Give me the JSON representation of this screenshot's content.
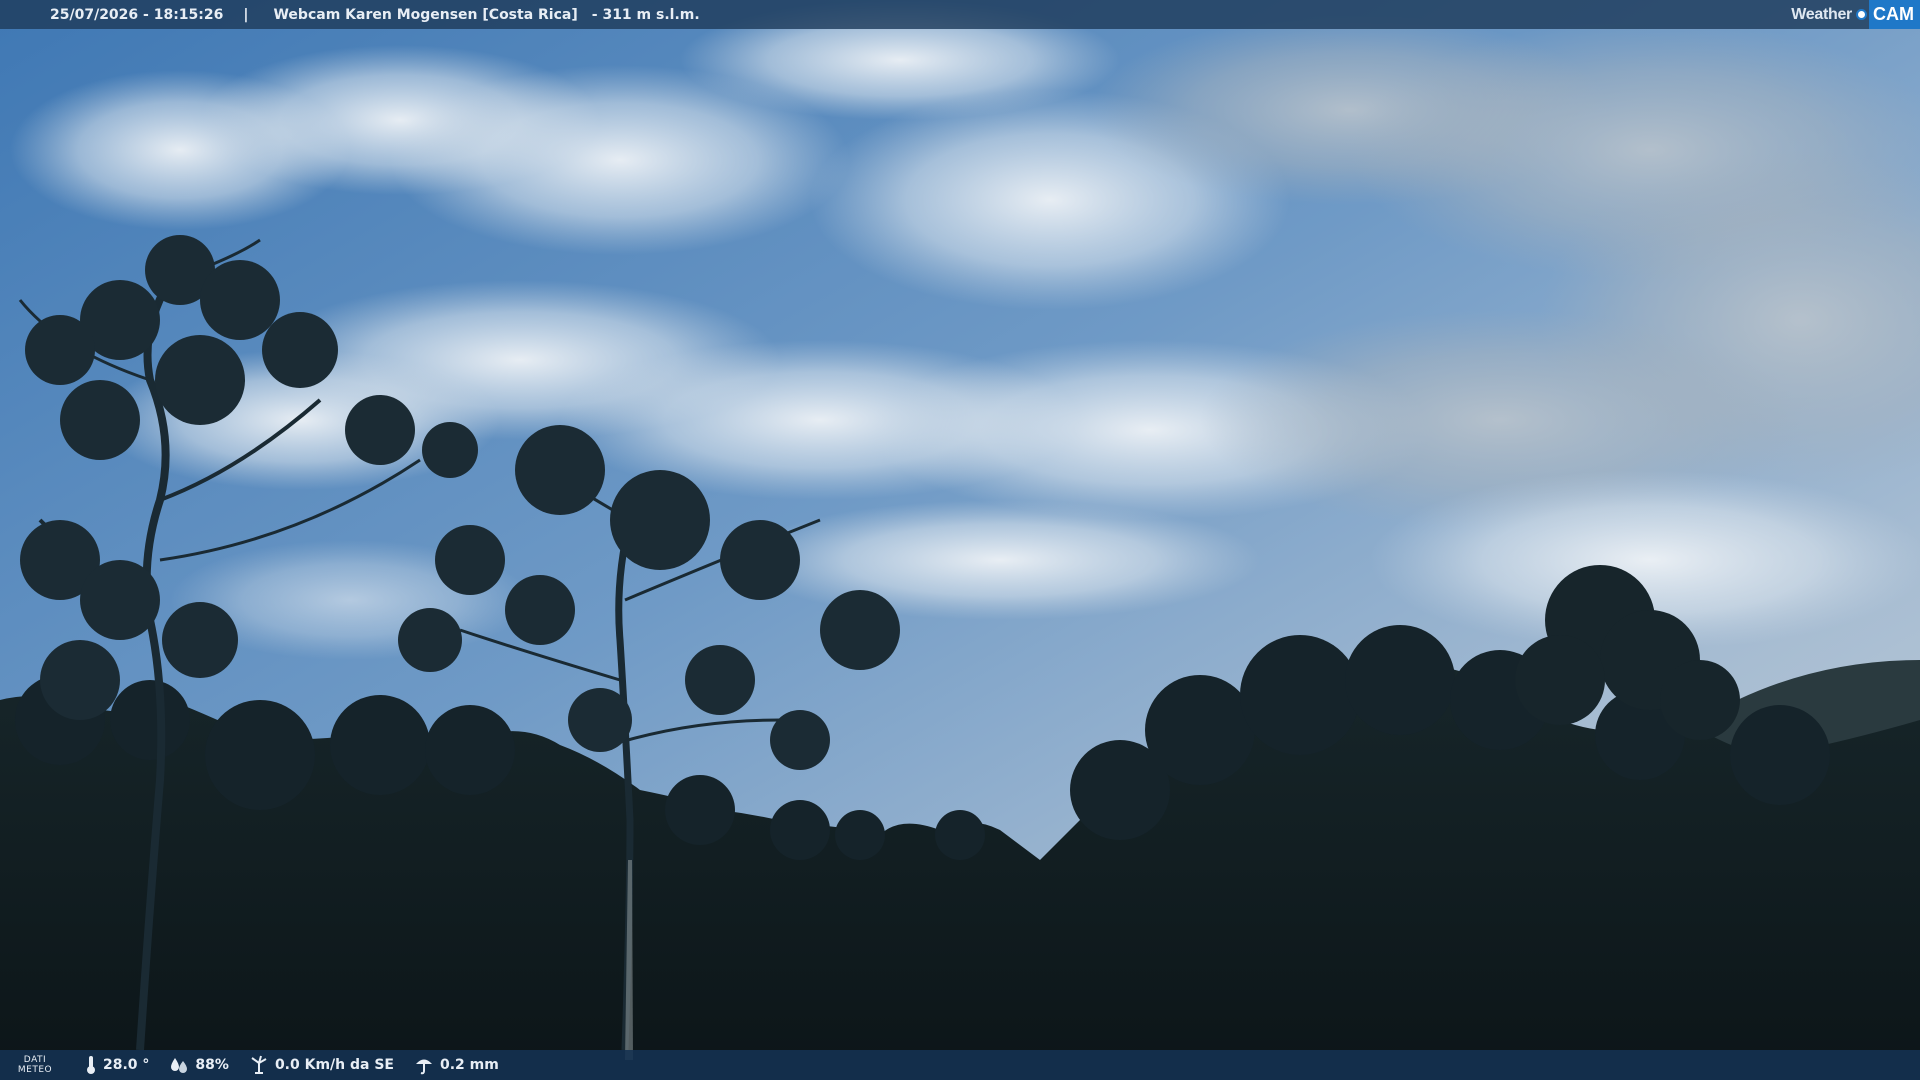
{
  "header": {
    "datetime": "25/07/2026 - 18:15:26",
    "separator": "|",
    "title": "Webcam Karen Mogensen [Costa Rica]",
    "elevation": "- 311 m s.l.m."
  },
  "logo": {
    "weather": "Weather",
    "cam": "CAM",
    "accent_color": "#1f78c8"
  },
  "weather_bar": {
    "label_line1": "DATI",
    "label_line2": "METEO",
    "temperature": "28.0 °",
    "humidity": "88%",
    "wind": "0.0 Km/h da SE",
    "rain": "0.2 mm",
    "icons": [
      "thermometer-icon",
      "humidity-icon",
      "wind-icon",
      "rain-icon"
    ]
  },
  "colors": {
    "bar_top": "#1e3c5c",
    "bar_bottom": "#143252",
    "sky_top": "#4a7fb5",
    "sky_horizon": "#9bb8d6",
    "vegetation": "#0f1a1e"
  }
}
